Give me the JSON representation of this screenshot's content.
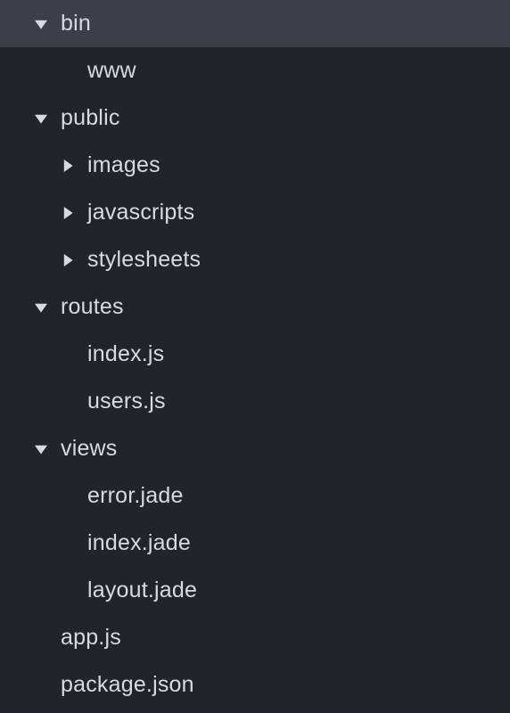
{
  "tree": [
    {
      "label": "bin",
      "type": "folder",
      "state": "open",
      "indent": 1,
      "selected": true
    },
    {
      "label": "www",
      "type": "file",
      "state": "none",
      "indent": 2,
      "selected": false
    },
    {
      "label": "public",
      "type": "folder",
      "state": "open",
      "indent": 1,
      "selected": false
    },
    {
      "label": "images",
      "type": "folder",
      "state": "closed",
      "indent": 2,
      "selected": false
    },
    {
      "label": "javascripts",
      "type": "folder",
      "state": "closed",
      "indent": 2,
      "selected": false
    },
    {
      "label": "stylesheets",
      "type": "folder",
      "state": "closed",
      "indent": 2,
      "selected": false
    },
    {
      "label": "routes",
      "type": "folder",
      "state": "open",
      "indent": 1,
      "selected": false
    },
    {
      "label": "index.js",
      "type": "file",
      "state": "none",
      "indent": 2,
      "selected": false
    },
    {
      "label": "users.js",
      "type": "file",
      "state": "none",
      "indent": 2,
      "selected": false
    },
    {
      "label": "views",
      "type": "folder",
      "state": "open",
      "indent": 1,
      "selected": false
    },
    {
      "label": "error.jade",
      "type": "file",
      "state": "none",
      "indent": 2,
      "selected": false
    },
    {
      "label": "index.jade",
      "type": "file",
      "state": "none",
      "indent": 2,
      "selected": false
    },
    {
      "label": "layout.jade",
      "type": "file",
      "state": "none",
      "indent": 2,
      "selected": false
    },
    {
      "label": "app.js",
      "type": "file",
      "state": "none",
      "indent": 1,
      "selected": false
    },
    {
      "label": "package.json",
      "type": "file",
      "state": "none",
      "indent": 1,
      "selected": false
    }
  ],
  "icons": {
    "open": "chevron-down-icon",
    "closed": "chevron-right-icon"
  }
}
